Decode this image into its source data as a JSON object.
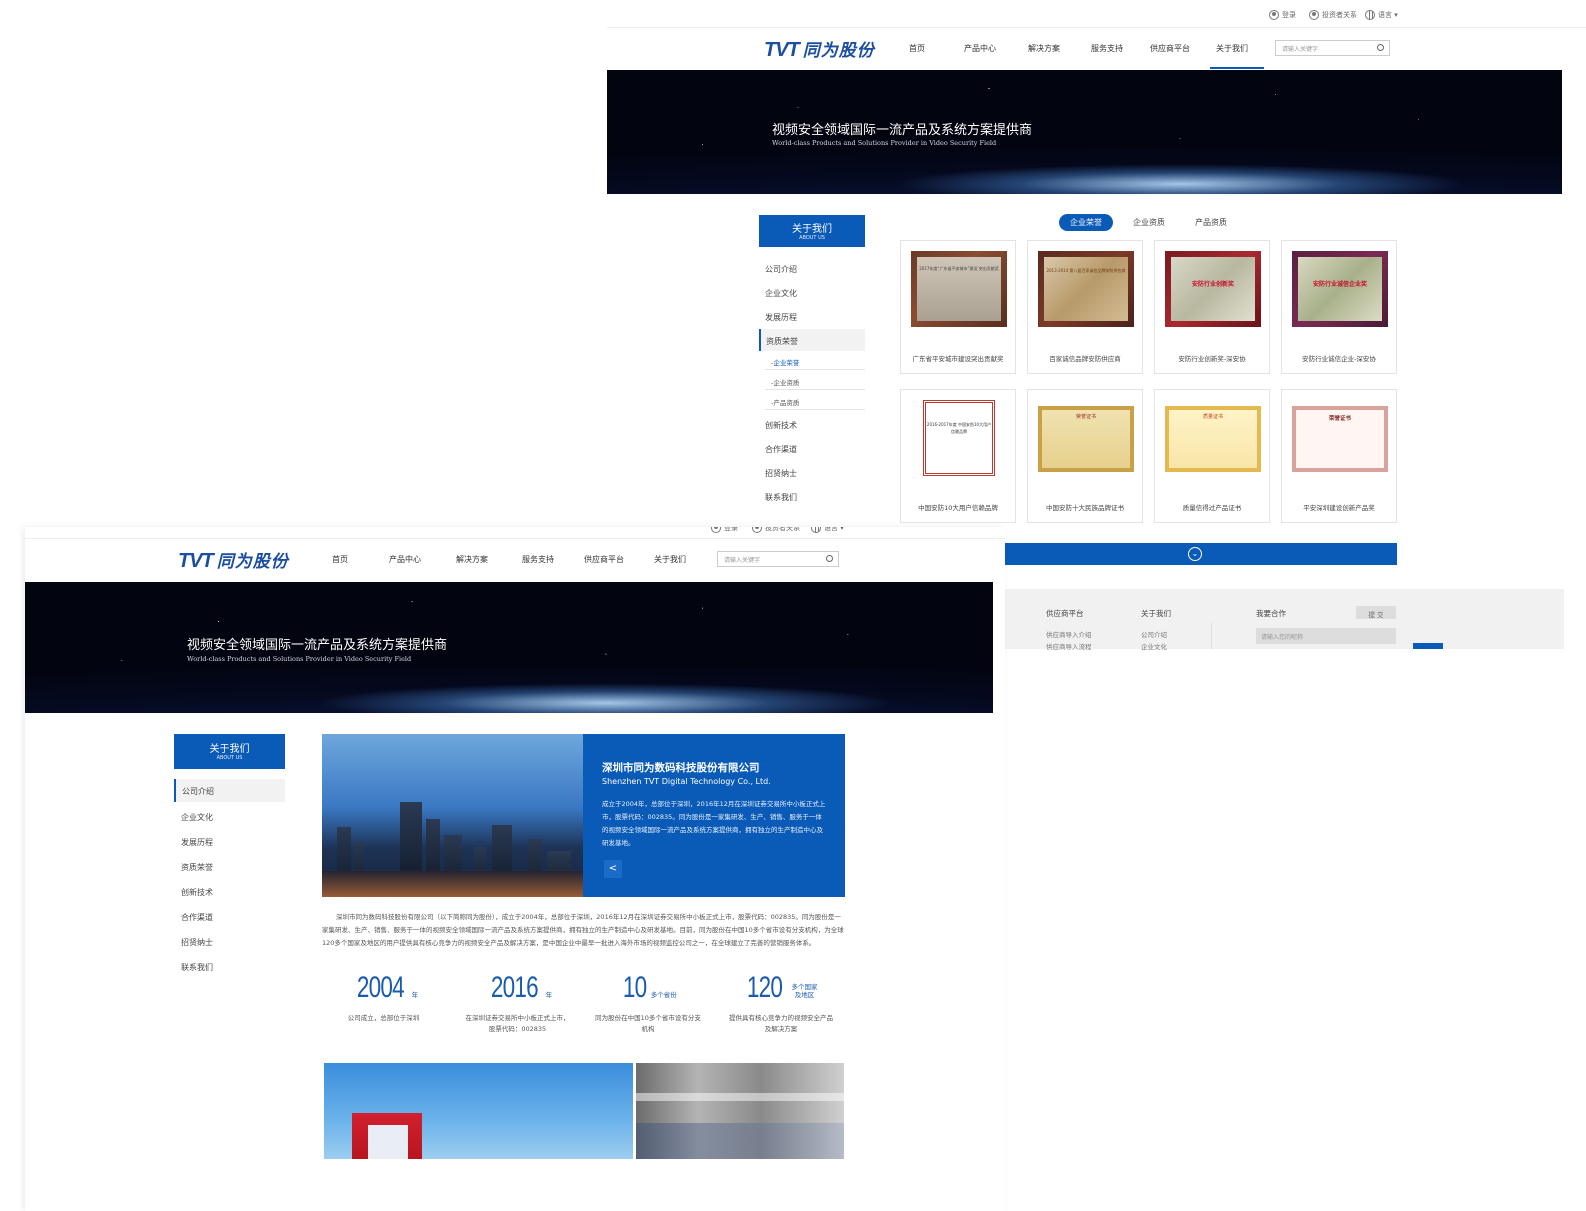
{
  "topbar": {
    "login": "登录",
    "investor": "投资者关系",
    "language": "语言 ▾"
  },
  "logo": {
    "tvt": "TVT",
    "cn": "同为股份"
  },
  "nav": {
    "items": [
      "首页",
      "产品中心",
      "解决方案",
      "服务支持",
      "供应商平台",
      "关于我们"
    ],
    "search_placeholder": "请输入关键字"
  },
  "banner": {
    "title": "视频安全领域国际一流产品及系统方案提供商",
    "subtitle": "World-class Products and Solutions Provider in Video Security Field"
  },
  "sidebar": {
    "head": "关于我们",
    "head_en": "ABOUT US",
    "items": [
      "公司介绍",
      "企业文化",
      "发展历程",
      "资质荣誉",
      "创新技术",
      "合作渠道",
      "招贤纳士",
      "联系我们"
    ],
    "sub_items": [
      "-企业荣誉",
      "-企业资质",
      "-产品资质"
    ]
  },
  "honors": {
    "tabs": [
      "企业荣誉",
      "企业资质",
      "产品资质"
    ],
    "cards": [
      "广东省平安城市建设突出贡献奖",
      "百家诚信品牌安防供应商",
      "安防行业创新奖-深安协",
      "安防行业诚信企业-深安协",
      "中国安防10大用户信赖品牌",
      "中国安防十大民族品牌证书",
      "质量信得过产品证书",
      "平安深圳建设创新产品奖"
    ],
    "card_lettering": [
      "2017年度“广东省平安城市”建设 突出贡献奖",
      "2013-2014 第八届百家诚信品牌安防供应商",
      "安防行业创新奖",
      "安防行业诚信企业奖",
      "2016-2017年度 中国安防10大用户信赖品牌",
      "荣誉证书",
      "质量证书",
      "荣誉证书"
    ],
    "more_icon": "chevron-down-icon"
  },
  "footer": {
    "col1": "供应商平台",
    "col1_links": [
      "供应商导入介绍",
      "供应商导入流程"
    ],
    "col2": "关于我们",
    "col2_links": [
      "公司介绍",
      "企业文化"
    ],
    "col3": "我要合作",
    "submit": "提 交",
    "name_placeholder": "请输入您的昵称"
  },
  "intro": {
    "title": "深圳市同为数码科技股份有限公司",
    "subtitle": "Shenzhen TVT Digital Technology Co., Ltd.",
    "body": "成立于2004年，总部位于深圳，2016年12月在深圳证券交易所中小板正式上市，股票代码：002835。同为股份是一家集研发、生产、销售、服务于一体的视频安全领域国际一流产品及系统方案提供商，拥有独立的生产制造中心及研发基地。",
    "share_icon": "share-icon",
    "paragraph": "深圳市同为数码科技股份有限公司（以下简称同为股份），成立于2004年，总部位于深圳，2016年12月在深圳证券交易所中小板正式上市，股票代码：002835。同为股份是一家集研发、生产、销售、服务于一体的视频安全领域国际一流产品及系统方案提供商，拥有独立的生产制造中心及研发基地。目前，同为股份在中国10多个省市设有分支机构，为全球120多个国家及地区的用户提供具有核心竞争力的视频安全产品及解决方案，是中国企业中最早一批进入海外市场的视频监控公司之一，在全球建立了完善的营销服务体系。"
  },
  "stats": [
    {
      "num": "2004",
      "unit": "年",
      "desc": "公司成立，总部位于深圳"
    },
    {
      "num": "2016",
      "unit": "年",
      "desc": "在深圳证券交易所中小板正式上市，股票代码：002835"
    },
    {
      "num": "10",
      "unit": "多个省份",
      "desc": "同为股份在中国10多个省市设有分支机构"
    },
    {
      "num": "120",
      "unit": "多个国家及地区",
      "desc": "提供具有核心竞争力的视频安全产品及解决方案"
    }
  ],
  "colors": {
    "brand_blue": "#0a5ab8",
    "logo_blue": "#1d4fa0"
  }
}
